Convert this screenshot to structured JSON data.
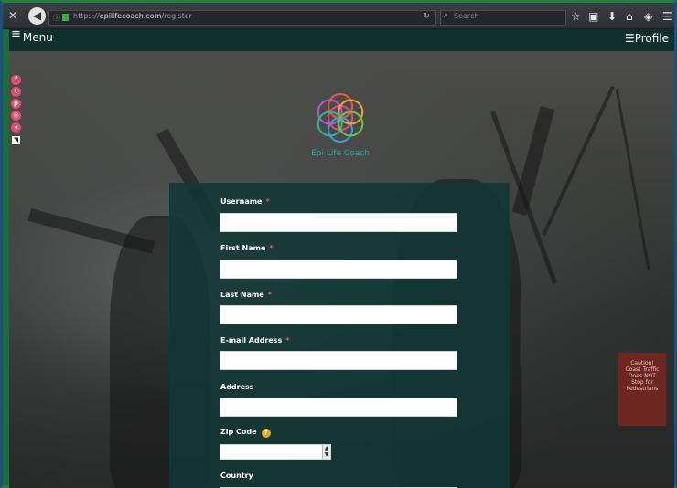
{
  "browser": {
    "url_domain": "epilifecoach.com",
    "url_prefix": "https://",
    "url_path": "/register",
    "search_placeholder": "Search"
  },
  "header": {
    "menu_label": "Menu",
    "profile_label": "Profile",
    "flags": [
      "#c0392b",
      "#1f4e9c",
      "#c0392b",
      "#2b5fa8",
      "#d4a017"
    ]
  },
  "social": {
    "icons": [
      "facebook-icon",
      "twitter-icon",
      "pinterest-icon",
      "instagram-icon",
      "share-icon"
    ],
    "colors": {
      "accent": "#e74c6a"
    }
  },
  "brand": {
    "name": "Epi Life Coach"
  },
  "form": {
    "username_label": "Username",
    "first_name_label": "First Name",
    "last_name_label": "Last Name",
    "email_label": "E-mail Address",
    "address_label": "Address",
    "zip_label": "Zip Code",
    "country_label": "Country",
    "required_mark": "*",
    "help_mark": "?"
  },
  "sign": {
    "text": "Caution! Coast Traffic Does NOT Stop for Pedestrians"
  },
  "colors": {
    "panel": "#123734",
    "header": "#11302b",
    "help": "#e2a722"
  }
}
